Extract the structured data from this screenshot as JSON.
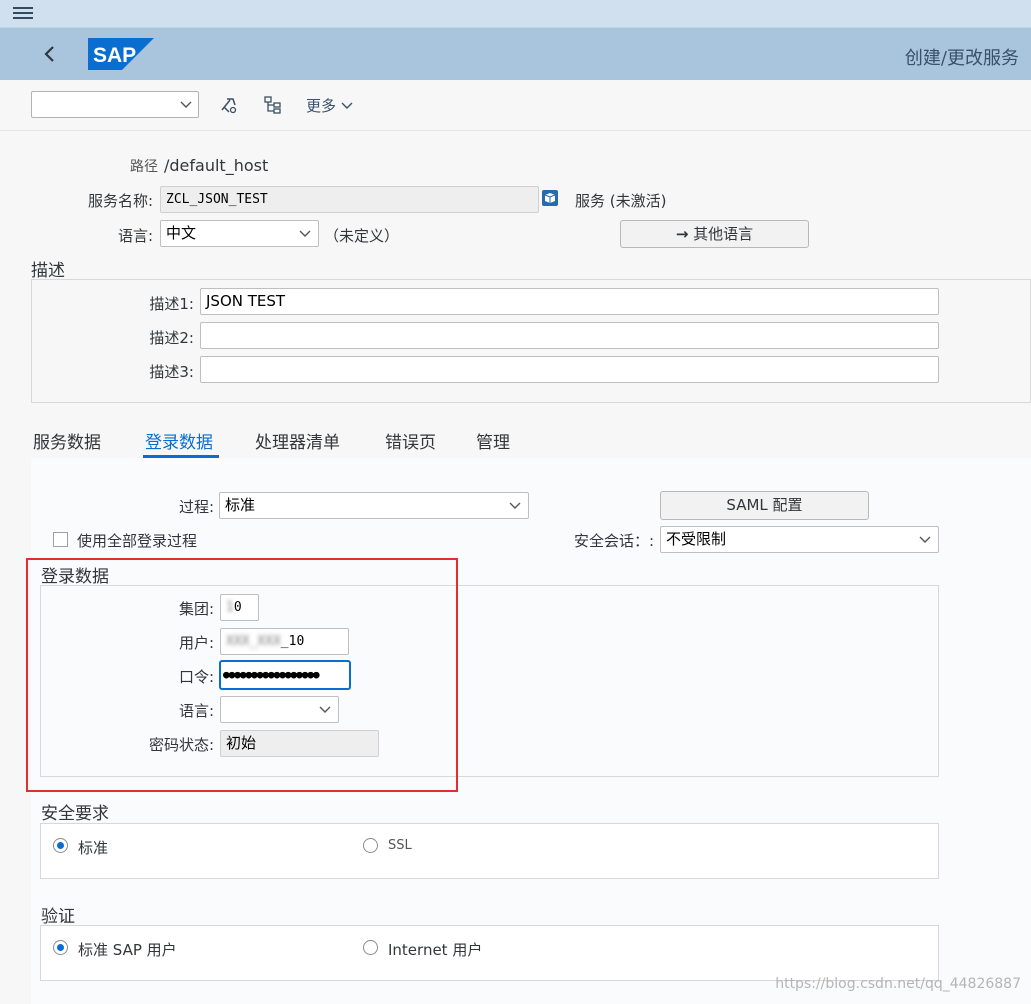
{
  "shell": {
    "title": "创建/更改服务",
    "logo": "SAP",
    "brand_color": "#0a6ed1"
  },
  "toolbar": {
    "select_value": "",
    "more_label": "更多"
  },
  "header": {
    "path_label": "路径",
    "path_value": "/default_host",
    "service_name_label": "服务名称:",
    "service_name_value": "ZCL_JSON_TEST",
    "service_status": "服务 (未激活)",
    "language_label": "语言:",
    "language_value": "中文",
    "language_note": "（未定义）",
    "other_languages_button": "其他语言"
  },
  "description": {
    "section_title": "描述",
    "rows": [
      {
        "label": "描述1:",
        "value": "JSON TEST"
      },
      {
        "label": "描述2:",
        "value": ""
      },
      {
        "label": "描述3:",
        "value": ""
      }
    ]
  },
  "tabs": [
    {
      "label": "服务数据",
      "active": false
    },
    {
      "label": "登录数据",
      "active": true
    },
    {
      "label": "处理器清单",
      "active": false
    },
    {
      "label": "错误页",
      "active": false
    },
    {
      "label": "管理",
      "active": false
    }
  ],
  "logon": {
    "procedure_label": "过程:",
    "procedure_value": "标准",
    "saml_button": "SAML 配置",
    "use_all_label": "使用全部登录过程",
    "security_session_label": "安全会话：:",
    "security_session_value": "不受限制",
    "logon_data_title": "登录数据",
    "client_label": "集团:",
    "client_value": "0",
    "user_label": "用户:",
    "user_value": "_10",
    "password_label": "口令:",
    "password_value": "●●●●●●●●●●●●●●●●●",
    "lang_label": "语言:",
    "lang_value": "",
    "pw_status_label": "密码状态:",
    "pw_status_value": "初始"
  },
  "security": {
    "title": "安全要求",
    "options": [
      {
        "label": "标准",
        "selected": true
      },
      {
        "label": "SSL",
        "selected": false
      }
    ]
  },
  "auth": {
    "title": "验证",
    "options": [
      {
        "label": "标准 SAP 用户",
        "selected": true
      },
      {
        "label": "Internet 用户",
        "selected": false
      }
    ]
  },
  "watermark": "https://blog.csdn.net/qq_44826887"
}
